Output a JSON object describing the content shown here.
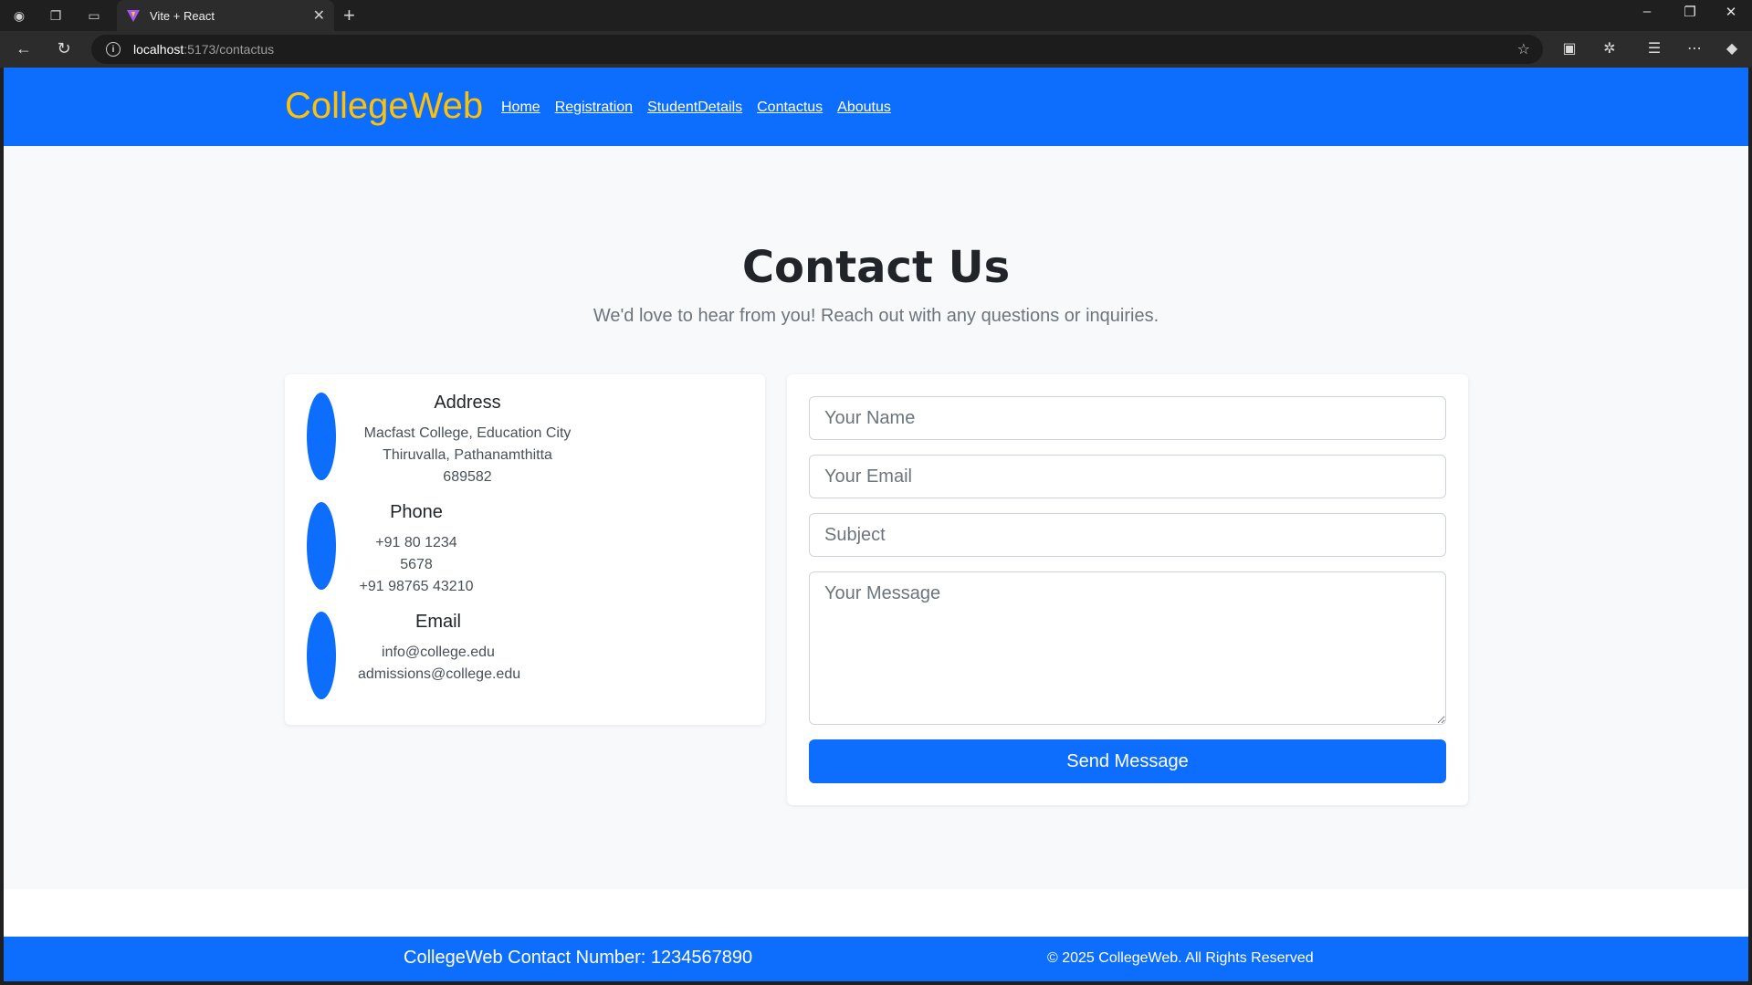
{
  "browser": {
    "tab_title": "Vite + React",
    "url_host": "localhost",
    "url_path": ":5173/contactus"
  },
  "navbar": {
    "brand": "CollegeWeb",
    "links": [
      "Home",
      "Registration",
      "StudentDetails",
      "Contactus",
      "Aboutus"
    ]
  },
  "page": {
    "title": "Contact Us",
    "subtitle": "We'd love to hear from you! Reach out with any questions or inquiries."
  },
  "contact_info": [
    {
      "title": "Address",
      "lines": [
        "Macfast College, Education City",
        "Thiruvalla, Pathanamthitta 689582"
      ]
    },
    {
      "title": "Phone",
      "lines": [
        "+91 80 1234 5678",
        "+91 98765 43210"
      ]
    },
    {
      "title": "Email",
      "lines": [
        "info@college.edu",
        "admissions@college.edu"
      ]
    }
  ],
  "form": {
    "name_placeholder": "Your Name",
    "email_placeholder": "Your Email",
    "subject_placeholder": "Subject",
    "message_placeholder": "Your Message",
    "submit_label": "Send Message"
  },
  "footer": {
    "contact": "CollegeWeb Contact Number: 1234567890",
    "copyright": "© 2025 CollegeWeb. All Rights Reserved"
  },
  "colors": {
    "primary": "#0d6efd",
    "brand": "#ffc107"
  }
}
